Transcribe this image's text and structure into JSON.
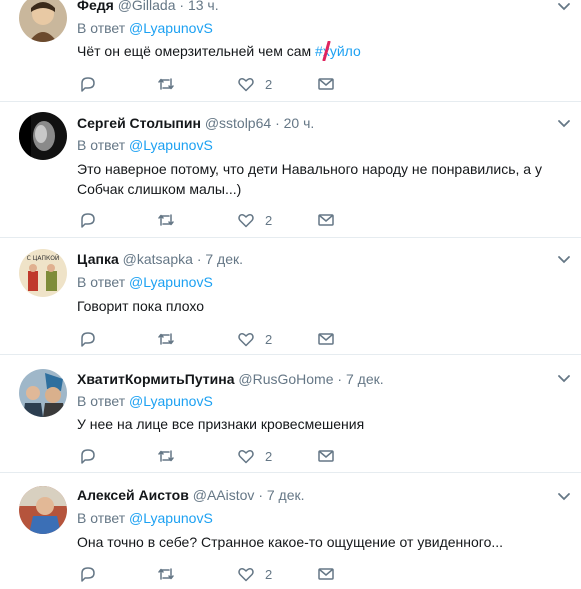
{
  "tweets": [
    {
      "name": "Федя",
      "handle": "@Gillada",
      "time": "13 ч.",
      "reply_prefix": "В ответ",
      "reply_to": "@LyapunovS",
      "text_plain": "Чёт он ещё омерзительней чем сам ",
      "text_hashtag": "#хуйло",
      "likes": "2"
    },
    {
      "name": "Сергей Столыпин",
      "handle": "@sstolp64",
      "time": "20 ч.",
      "reply_prefix": "В ответ",
      "reply_to": "@LyapunovS",
      "text": "Это наверное потому, что дети Навального народу не понравились, а у Собчак слишком малы...)",
      "likes": "2"
    },
    {
      "name": "Цапка",
      "handle": "@katsapka",
      "time": "7 дек.",
      "reply_prefix": "В ответ",
      "reply_to": "@LyapunovS",
      "text": "Говорит пока плохо",
      "likes": "2"
    },
    {
      "name": "ХватитКормитьПутина",
      "handle": "@RusGoHome",
      "time": "7 дек.",
      "reply_prefix": "В ответ",
      "reply_to": "@LyapunovS",
      "text": "У нее на лице все признаки кровесмешения",
      "likes": "2"
    },
    {
      "name": "Алексей Аистов",
      "handle": "@AAistov",
      "time": "7 дек.",
      "reply_prefix": "В ответ",
      "reply_to": "@LyapunovS",
      "text": "Она точно в себе? Странное какое-то ощущение от увиденного...",
      "likes": "2"
    }
  ],
  "avatar_text": "С ЦАПКОЙ",
  "icons": {
    "reply": "reply-icon",
    "retweet": "retweet-icon",
    "like": "heart-icon",
    "dm": "envelope-icon",
    "menu": "chevron-down-icon"
  },
  "colors": {
    "link": "#1da1f2",
    "muted": "#657786",
    "text": "#14171a",
    "divider": "#e6ecf0",
    "censor_mark": "#e0245e"
  }
}
